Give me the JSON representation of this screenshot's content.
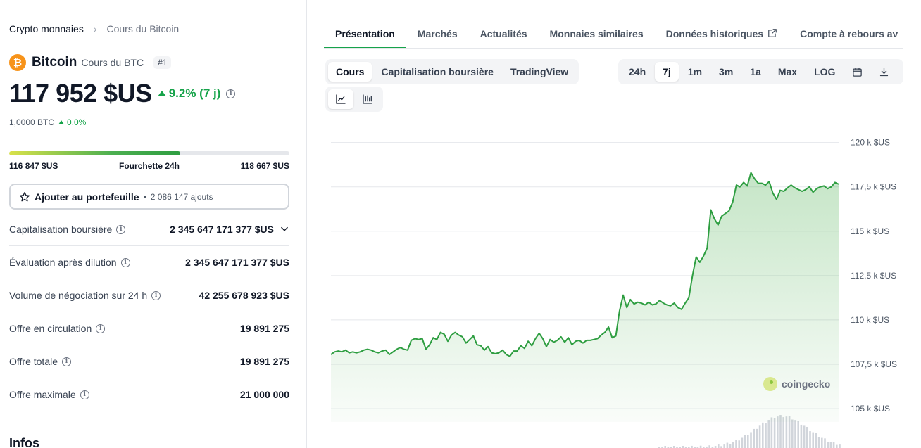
{
  "breadcrumb": {
    "root": "Crypto monnaies",
    "current": "Cours du Bitcoin"
  },
  "coin": {
    "name": "Bitcoin",
    "subtitle": "Cours du BTC",
    "rank": "#1",
    "logo_symbol": "₿"
  },
  "price": {
    "value": "117 952 $US",
    "change": "9.2% (7 j)",
    "btc_value": "1,0000 BTC",
    "btc_change": "0.0%"
  },
  "range_24h": {
    "low": "116 847 $US",
    "label": "Fourchette 24h",
    "high": "118 667 $US",
    "position_fraction": 0.61
  },
  "portfolio": {
    "label": "Ajouter au portefeuille",
    "separator": "•",
    "count": "2 086 147 ajouts"
  },
  "stats": [
    {
      "label": "Capitalisation boursière",
      "value": "2 345 647 171 377 $US",
      "has_dropdown": true
    },
    {
      "label": "Évaluation après dilution",
      "value": "2 345 647 171 377 $US",
      "has_dropdown": false
    },
    {
      "label": "Volume de négociation sur 24 h",
      "value": "42 255 678 923 $US",
      "has_dropdown": false
    },
    {
      "label": "Offre en circulation",
      "value": "19 891 275",
      "has_dropdown": false
    },
    {
      "label": "Offre totale",
      "value": "19 891 275",
      "has_dropdown": false
    },
    {
      "label": "Offre maximale",
      "value": "21 000 000",
      "has_dropdown": false
    }
  ],
  "infos_heading": "Infos",
  "tabs": [
    {
      "label": "Présentation",
      "active": true
    },
    {
      "label": "Marchés",
      "active": false
    },
    {
      "label": "Actualités",
      "active": false
    },
    {
      "label": "Monnaies similaires",
      "active": false
    },
    {
      "label": "Données historiques",
      "active": false,
      "external": true
    },
    {
      "label": "Compte à rebours av",
      "active": false
    }
  ],
  "chart_type_tabs": [
    {
      "label": "Cours",
      "active": true
    },
    {
      "label": "Capitalisation boursière",
      "active": false
    },
    {
      "label": "TradingView",
      "active": false
    }
  ],
  "chart_style_icons": [
    "line-chart-icon",
    "candlestick-chart-icon"
  ],
  "range_tabs": [
    {
      "label": "24h",
      "active": false
    },
    {
      "label": "7j",
      "active": true
    },
    {
      "label": "1m",
      "active": false
    },
    {
      "label": "3m",
      "active": false
    },
    {
      "label": "1a",
      "active": false
    },
    {
      "label": "Max",
      "active": false
    },
    {
      "label": "LOG",
      "active": false
    }
  ],
  "range_icons": [
    "calendar-icon",
    "download-icon"
  ],
  "watermark": "coingecko",
  "colors": {
    "accent_green": "#16a34a",
    "line_green": "#2e9e41",
    "area_fill": "#c8e6c9",
    "btc_orange": "#f7931a"
  },
  "chart_data": {
    "type": "area",
    "title": "",
    "xlabel": "",
    "ylabel": "",
    "y_unit": "$US",
    "ylim": [
      104250,
      120500
    ],
    "y_ticks": [
      {
        "value": 120000,
        "label": "120 k $US"
      },
      {
        "value": 117500,
        "label": "117,5 k $US"
      },
      {
        "value": 115000,
        "label": "115 k $US"
      },
      {
        "value": 112500,
        "label": "112,5 k $US"
      },
      {
        "value": 110000,
        "label": "110 k $US"
      },
      {
        "value": 107500,
        "label": "107,5 k $US"
      },
      {
        "value": 105000,
        "label": "105 k $US"
      }
    ],
    "grid": true,
    "series": [
      {
        "values": [
          108050,
          108200,
          108250,
          108200,
          108300,
          108150,
          108200,
          108150,
          108200,
          108300,
          108350,
          108300,
          108200,
          108150,
          108250,
          108300,
          108050,
          108200,
          108350,
          108450,
          108350,
          108300,
          108850,
          108950,
          108900,
          108950,
          108350,
          108600,
          109000,
          108900,
          109300,
          109200,
          108800,
          109150,
          109300,
          109150,
          109050,
          108700,
          108900,
          109100,
          108600,
          108550,
          108300,
          108500,
          108150,
          108100,
          108150,
          108300,
          108050,
          107950,
          108250,
          108250,
          108550,
          108400,
          108800,
          108550,
          108950,
          109250,
          108950,
          108500,
          108900,
          108750,
          108850,
          109050,
          108750,
          109000,
          108600,
          108800,
          108850,
          108700,
          108850,
          108850,
          108900,
          108950,
          109150,
          109300,
          109600,
          109000,
          109100,
          110500,
          111400,
          110700,
          111150,
          110900,
          111000,
          110950,
          110850,
          111000,
          110850,
          110900,
          111100,
          110950,
          110850,
          110800,
          110950,
          110700,
          110600,
          110950,
          111250,
          112500,
          113550,
          113250,
          113600,
          114050,
          116200,
          115700,
          115350,
          115850,
          116000,
          116150,
          116650,
          117600,
          117500,
          117750,
          117550,
          118300,
          117950,
          117700,
          117700,
          117600,
          117800,
          117150,
          116800,
          117300,
          117250,
          117450,
          117600,
          117450,
          117350,
          117250,
          117350,
          117500,
          117200,
          117400,
          117500,
          117550,
          117400,
          117500,
          117750,
          117650
        ]
      }
    ],
    "volume_bars": true
  }
}
